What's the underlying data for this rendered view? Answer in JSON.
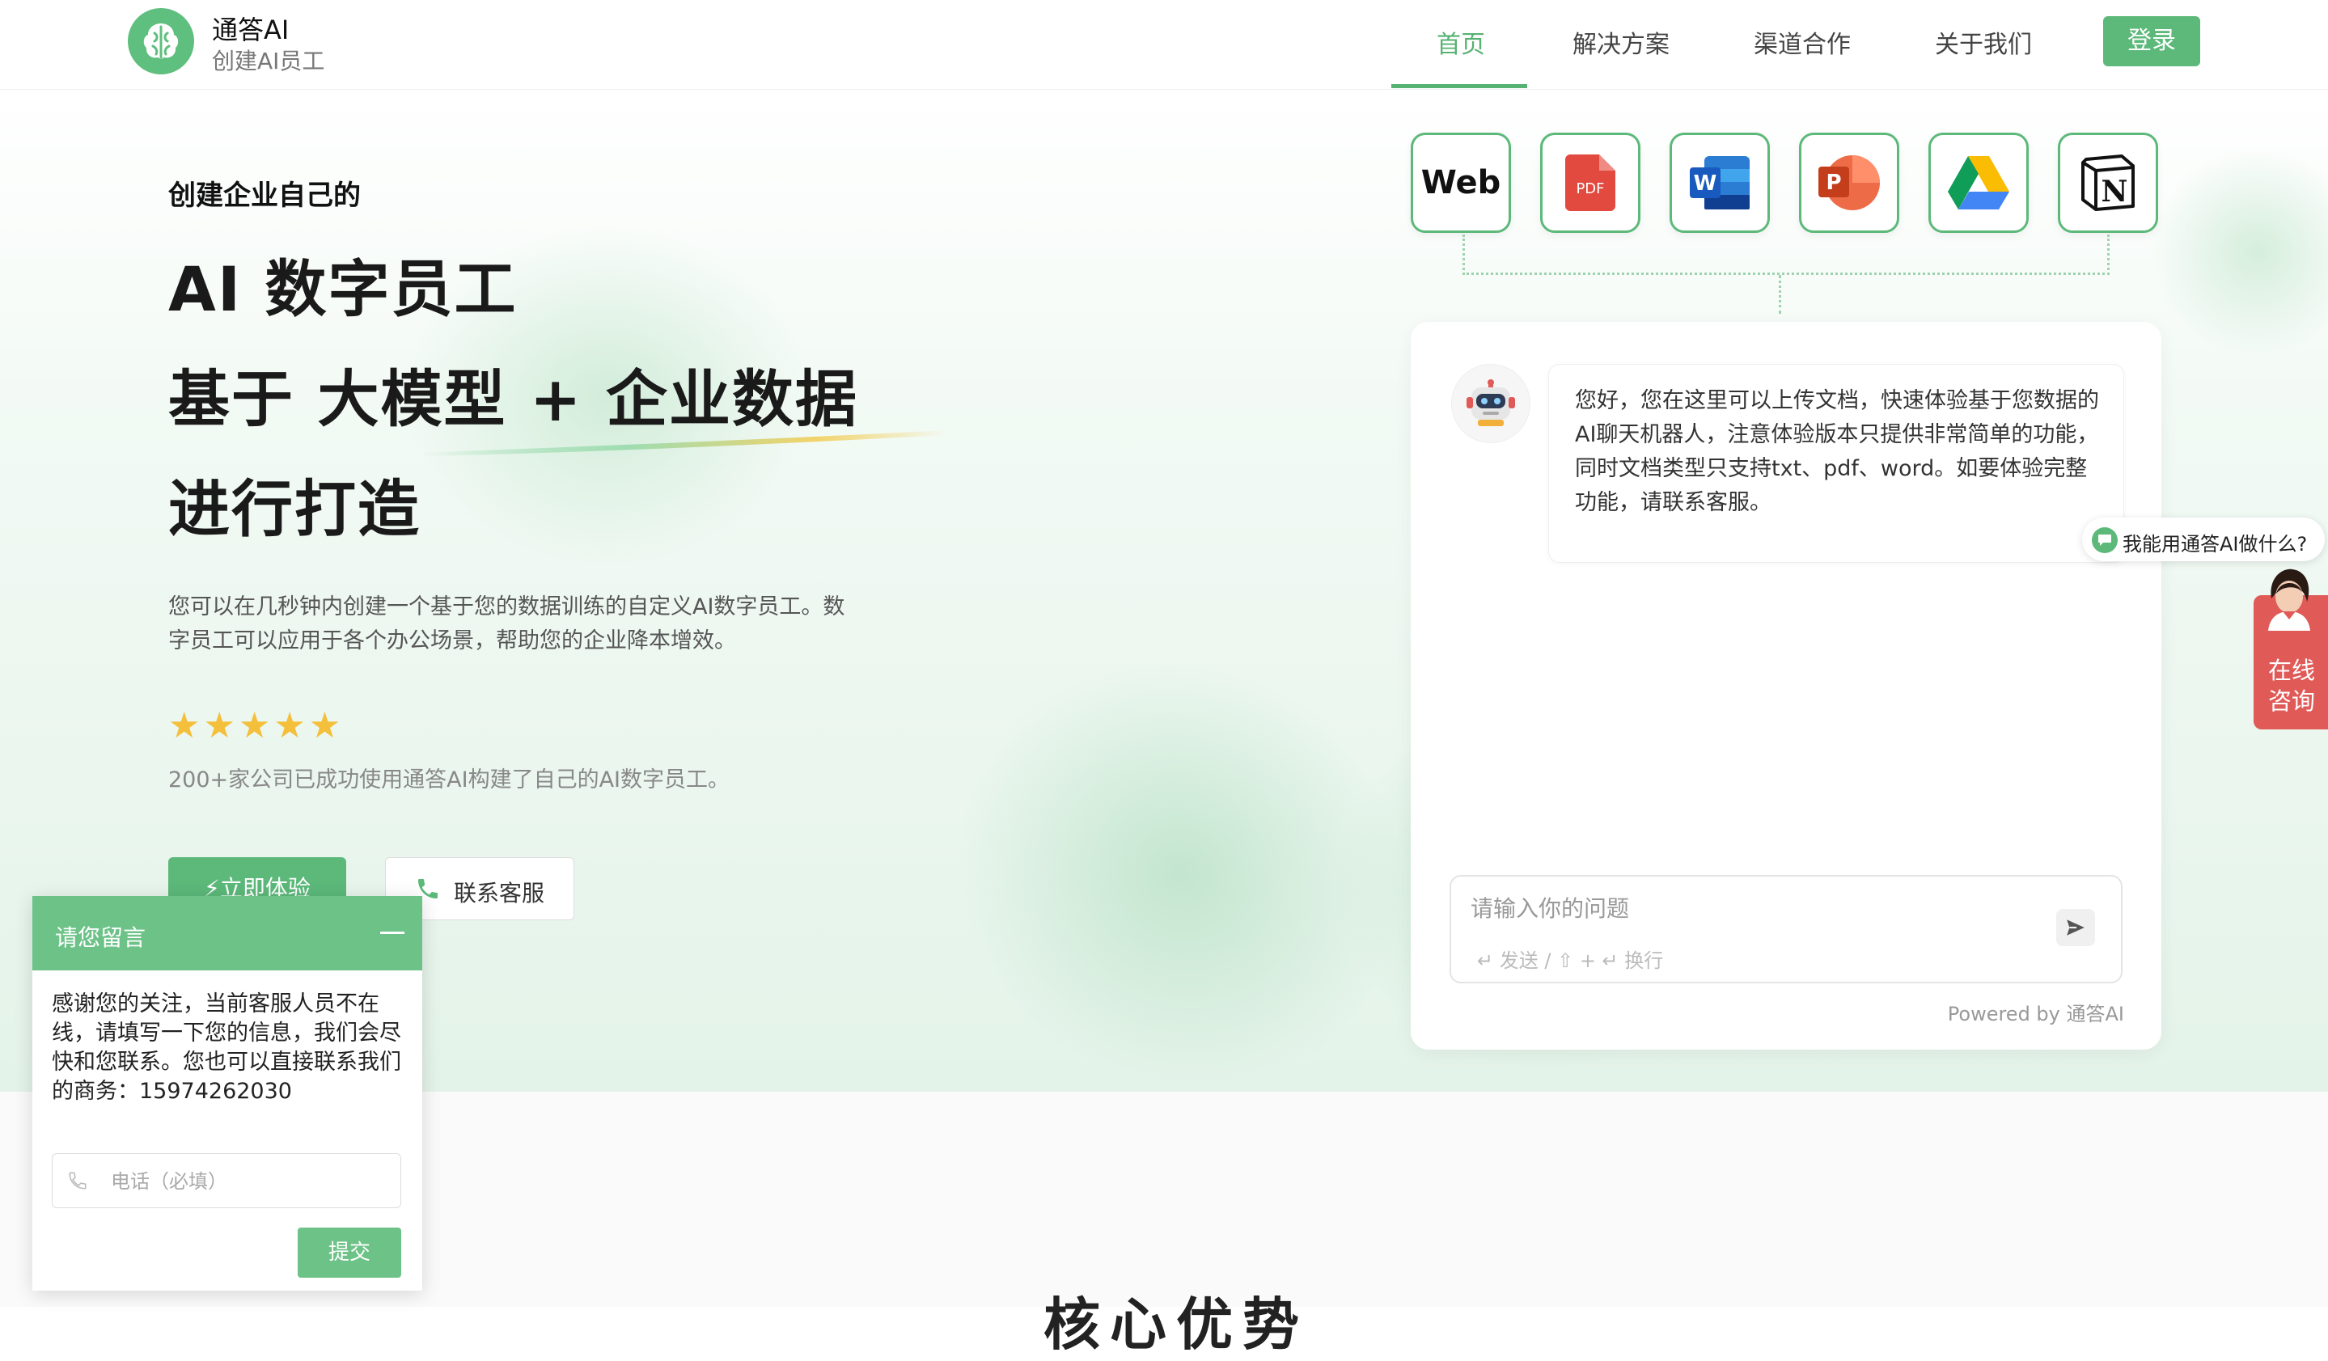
{
  "header": {
    "brand_name": "通答AI",
    "brand_tagline": "创建AI员工",
    "nav": [
      {
        "label": "首页",
        "active": true
      },
      {
        "label": "解决方案",
        "active": false
      },
      {
        "label": "渠道合作",
        "active": false
      },
      {
        "label": "关于我们",
        "active": false
      }
    ],
    "login_label": "登录",
    "accent_color": "#5cb97a"
  },
  "hero": {
    "pre_title": "创建企业自己的",
    "title_lines": [
      "AI 数字员工",
      "基于 大模型 + 企业数据",
      "进行打造"
    ],
    "description": "您可以在几秒钟内创建一个基于您的数据训练的自定义AI数字员工。数字员工可以应用于各个办公场景，帮助您的企业降本增效。",
    "rating": 5,
    "stars": "★★★★★",
    "social_proof": "200+家公司已成功使用通答AI构建了自己的AI数字员工。",
    "try_button": "⚡立即体验",
    "contact_button": "联系客服"
  },
  "sources": [
    {
      "name": "Web",
      "icon": "web-icon"
    },
    {
      "name": "PDF",
      "icon": "pdf-icon"
    },
    {
      "name": "W",
      "icon": "word-icon"
    },
    {
      "name": "P",
      "icon": "powerpoint-icon"
    },
    {
      "name": "Google Drive",
      "icon": "google-drive-icon"
    },
    {
      "name": "N",
      "icon": "notion-icon"
    }
  ],
  "chat": {
    "greeting": "您好，您在这里可以上传文档，快速体验基于您数据的AI聊天机器人，注意体验版本只提供非常简单的功能，同时文档类型只支持txt、pdf、word。如要体验完整功能，请联系客服。",
    "input_placeholder": "请输入你的问题",
    "hint": "↵ 发送 / ⇧ + ↵ 换行",
    "powered_by": "Powered by 通答AI"
  },
  "floating": {
    "ask_prompt": "我能用通答AI做什么?",
    "service_label": "在线咨询"
  },
  "message_popup": {
    "title": "请您留言",
    "message": "感谢您的关注，当前客服人员不在线，请填写一下您的信息，我们会尽快和您联系。您也可以直接联系我们的商务：15974262030",
    "phone_placeholder": "电话（必填）",
    "submit_label": "提交"
  },
  "lower_section": {
    "heading": "核心优势"
  }
}
